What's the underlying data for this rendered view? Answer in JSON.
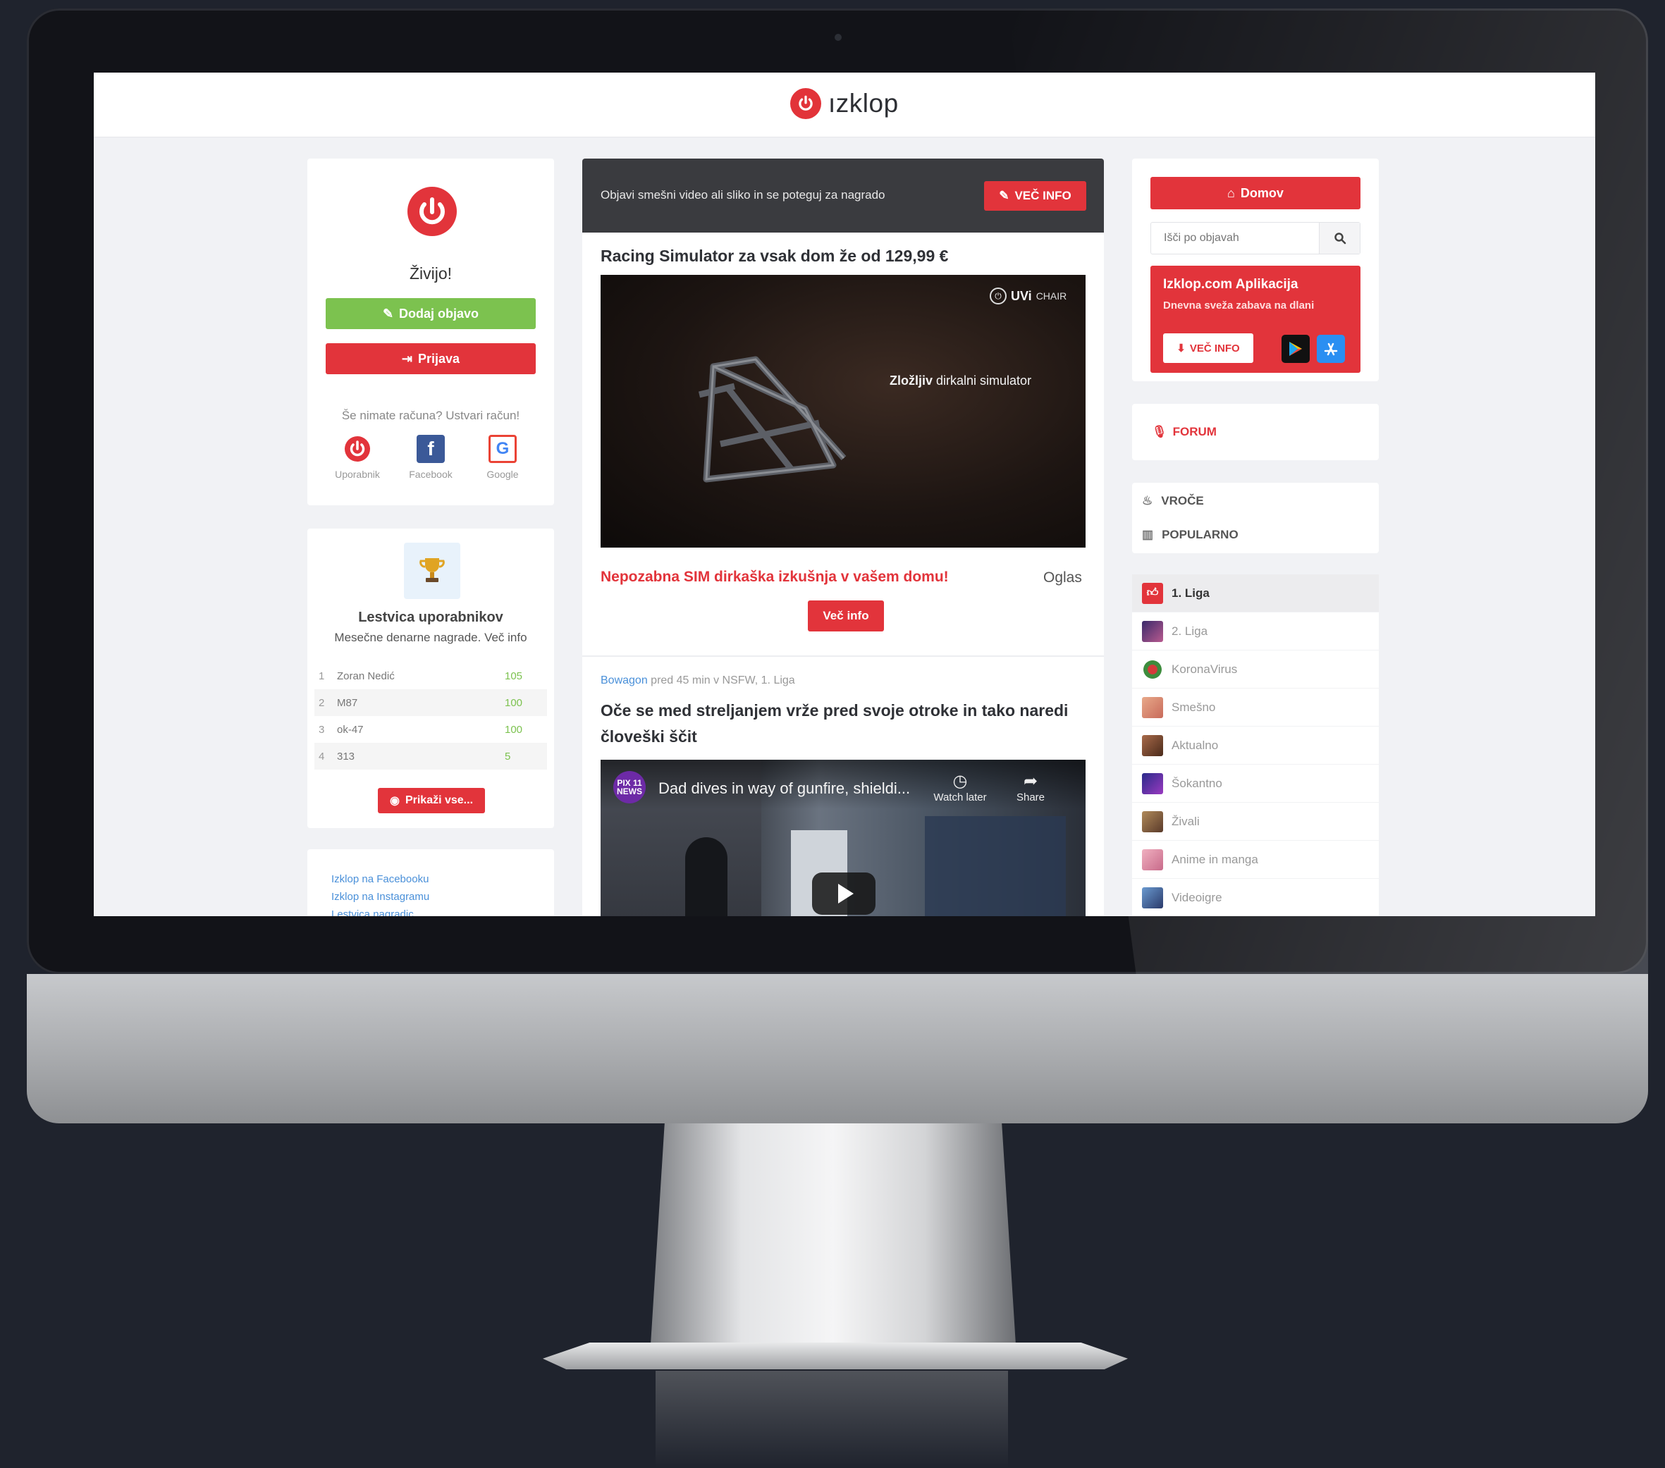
{
  "header": {
    "logo_text": "ızklop"
  },
  "left": {
    "greeting": "Živijo!",
    "add_post": "Dodaj objavo",
    "login": "Prijava",
    "no_account": "Še nimate računa? Ustvari račun!",
    "social": [
      {
        "label": "Uporabnik",
        "icon": "power-icon",
        "color": "#e2343b"
      },
      {
        "label": "Facebook",
        "icon": "facebook-icon",
        "color": "#3b5998"
      },
      {
        "label": "Google",
        "icon": "google-icon",
        "color": "#ea4335"
      }
    ],
    "leaderboard": {
      "title": "Lestvica uporabnikov",
      "subtitle": "Mesečne denarne nagrade. Več info",
      "rows": [
        {
          "rank": "1",
          "name": "Zoran Nedić",
          "points": "105"
        },
        {
          "rank": "2",
          "name": "M87",
          "points": "100"
        },
        {
          "rank": "3",
          "name": "ok-47",
          "points": "100"
        },
        {
          "rank": "4",
          "name": "313",
          "points": "5"
        }
      ],
      "show_all": "Prikaži vse..."
    },
    "links": [
      "Izklop na Facebooku",
      "Izklop na Instagramu",
      "Lestvica nagradic"
    ]
  },
  "main": {
    "banner_text": "Objavi smešni video ali sliko in se poteguj za nagrado",
    "banner_button": "VEČ INFO",
    "ad": {
      "title": "Racing Simulator za vsak dom že od 129,99 €",
      "brand": "UVi",
      "brand_suffix": "CHAIR",
      "caption_bold": "Zložljiv",
      "caption_rest": " dirkalni simulator",
      "link": "Nepozabna SIM dirkaška izkušnja v vašem domu!",
      "label": "Oglas",
      "button": "Več info"
    },
    "post": {
      "user": "Bowagon",
      "meta_rest": " pred 45 min v NSFW, 1. Liga",
      "title": "Oče se med streljanjem vrže pred svoje otroke in tako naredi človeški ščit",
      "video_channel": "PIX 11 NEWS",
      "video_title": "Dad dives in way of gunfire, shieldi...",
      "watch_later": "Watch later",
      "share": "Share"
    }
  },
  "right": {
    "home": "Domov",
    "search_placeholder": "Išči po objavah",
    "app_title": "Izklop.com Aplikacija",
    "app_sub": "Dnevna sveža zabava na dlani",
    "app_button": "VEČ INFO",
    "forum": "FORUM",
    "sort": [
      {
        "label": "VROČE",
        "icon": "flame-icon"
      },
      {
        "label": "POPULARNO",
        "icon": "bar-chart-icon"
      }
    ],
    "categories": [
      {
        "label": "1. Liga",
        "color": "#e2343b",
        "active": true
      },
      {
        "label": "2. Liga",
        "color": "#7a3b8f"
      },
      {
        "label": "KoronaVirus",
        "color": "#3d8c3d"
      },
      {
        "label": "Smešno",
        "color": "#d98a6a"
      },
      {
        "label": "Aktualno",
        "color": "#8a4b3a"
      },
      {
        "label": "Šokantno",
        "color": "#5a3ca0"
      },
      {
        "label": "Živali",
        "color": "#8a6a4a"
      },
      {
        "label": "Anime in manga",
        "color": "#d88a9a"
      },
      {
        "label": "Videoigre",
        "color": "#3a5a8a"
      }
    ]
  },
  "colors": {
    "accent": "#e2343b",
    "green": "#7cc24f",
    "link": "#4a90d9"
  }
}
